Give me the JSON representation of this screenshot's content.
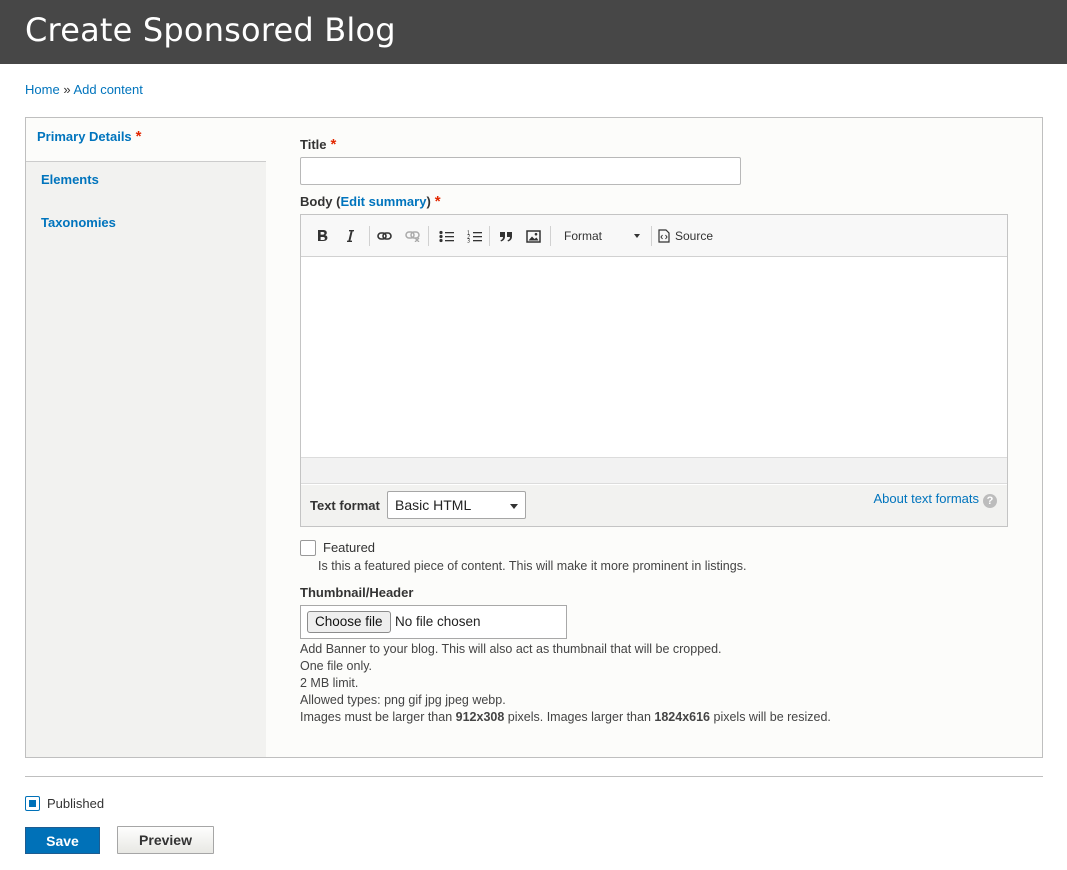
{
  "page": {
    "title": "Create Sponsored Blog"
  },
  "breadcrumb": {
    "home": "Home",
    "separator": "»",
    "add_content": "Add content"
  },
  "vtabs": [
    {
      "label": "Primary Details",
      "required": "*"
    },
    {
      "label": "Elements"
    },
    {
      "label": "Taxonomies"
    }
  ],
  "fields": {
    "title": {
      "label": "Title",
      "required": "*",
      "value": ""
    },
    "body": {
      "label": "Body",
      "edit_summary": "Edit summary",
      "required": "*"
    }
  },
  "toolbar": {
    "icons": [
      "bold-icon",
      "italic-icon",
      "link-icon",
      "unlink-icon",
      "bulleted-list-icon",
      "numbered-list-icon",
      "blockquote-icon",
      "image-icon",
      "source-icon"
    ],
    "format_label": "Format",
    "source_label": "Source"
  },
  "text_format": {
    "label": "Text format",
    "selected": "Basic HTML",
    "about_link": "About text formats",
    "help_glyph": "?"
  },
  "featured": {
    "label": "Featured",
    "checked": false,
    "description": "Is this a featured piece of content. This will make it more prominent in listings."
  },
  "thumbnail": {
    "label": "Thumbnail/Header",
    "button": "Choose file",
    "status": "No file chosen",
    "help": [
      "Add Banner to your blog. This will also act as thumbnail that will be cropped.",
      "One file only.",
      "2 MB limit.",
      "Allowed types: png gif jpg jpeg webp."
    ],
    "size_note": {
      "part1": "Images must be larger than ",
      "min": "912x308",
      "part2": " pixels. Images larger than ",
      "max": "1824x616",
      "part3": " pixels will be resized."
    }
  },
  "published": {
    "label": "Published",
    "checked": true
  },
  "actions": {
    "save": "Save",
    "preview": "Preview"
  },
  "colors": {
    "header_bg": "#474747",
    "link": "#0074bd",
    "required": "#e32700",
    "save_bg": "#0071b8"
  }
}
